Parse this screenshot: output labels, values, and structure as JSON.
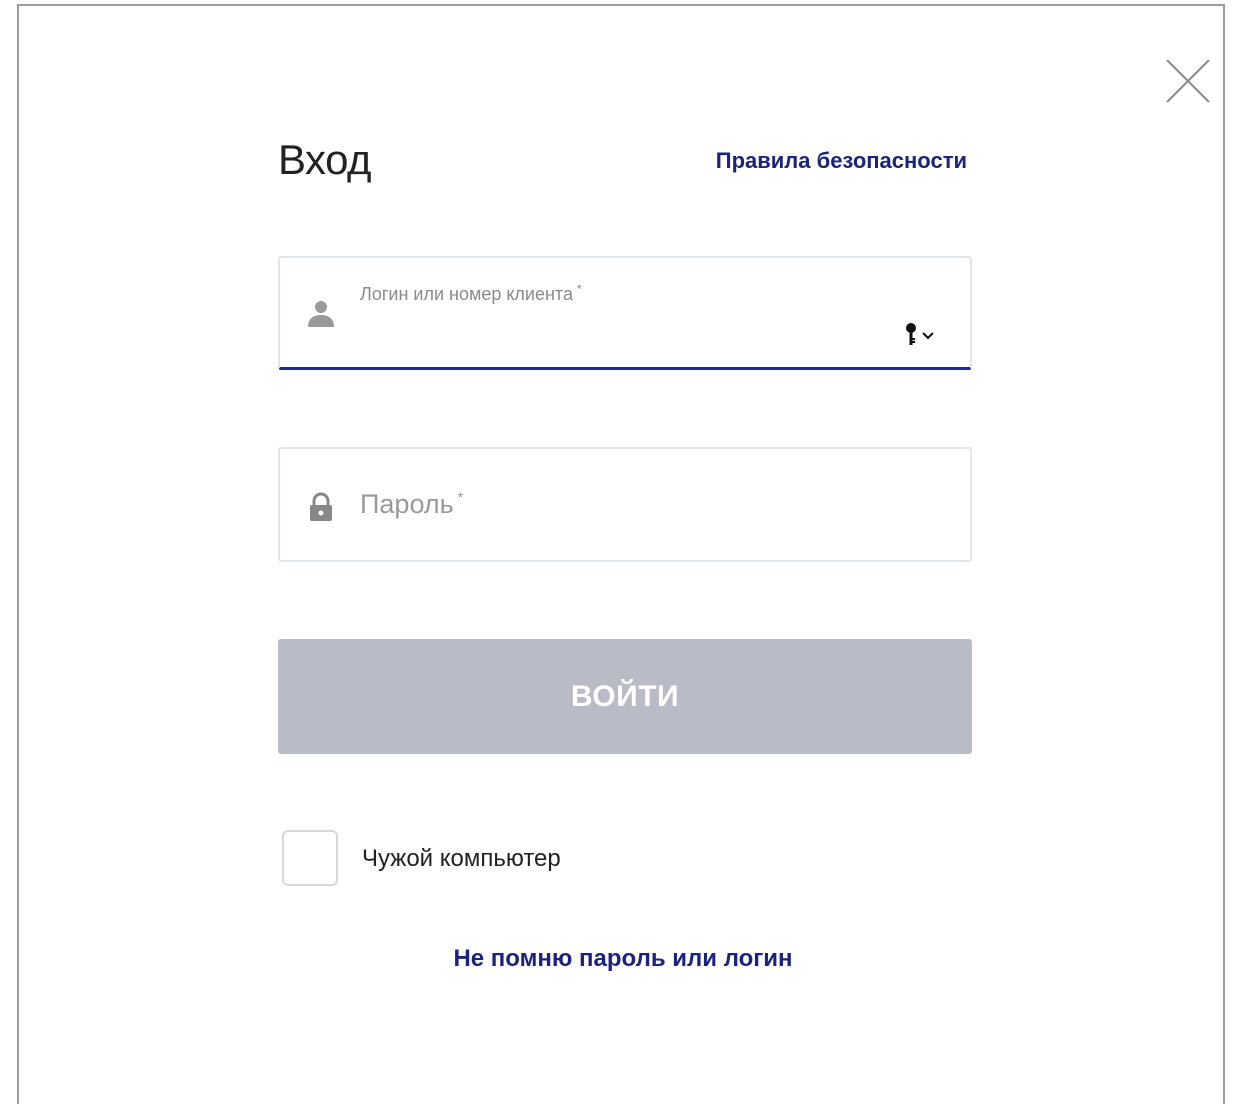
{
  "dialog": {
    "title": "Вход",
    "security_link": "Правила безопасности",
    "close_icon": "close-icon"
  },
  "login_field": {
    "label": "Логин или номер клиента",
    "required_mark": "*",
    "value": "",
    "icon": "user-icon",
    "dropdown_icon": "key-icon"
  },
  "password_field": {
    "label": "Пароль",
    "required_mark": "*",
    "value": "",
    "icon": "lock-icon"
  },
  "submit": {
    "label": "ВОЙТИ"
  },
  "foreign_computer": {
    "label": "Чужой компьютер",
    "checked": false
  },
  "forgot_link": {
    "label": "Не помню пароль или логин"
  },
  "colors": {
    "link": "#1a237e",
    "active_underline": "#1f2b95",
    "button_disabled": "#b9bcc7"
  }
}
